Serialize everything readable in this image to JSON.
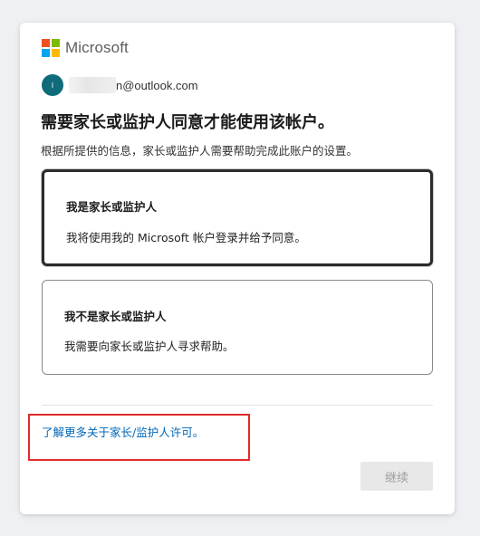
{
  "brand": {
    "name": "Microsoft"
  },
  "account": {
    "avatar_initial": "I",
    "email_visible": "n@outlook.com"
  },
  "header": {
    "title": "需要家长或监护人同意才能使用该帐户。",
    "subtitle": "根据所提供的信息，家长或监护人需要帮助完成此账户的设置。"
  },
  "options": [
    {
      "title": "我是家长或监护人",
      "description": "我将使用我的 Microsoft 帐户登录并给予同意。",
      "selected": true
    },
    {
      "title": "我不是家长或监护人",
      "description": "我需要向家长或监护人寻求帮助。",
      "selected": false
    }
  ],
  "footer": {
    "learn_more": "了解更多关于家长/监护人许可。",
    "continue_label": "继续"
  },
  "colors": {
    "link": "#0067b8",
    "highlight": "#e02b2b",
    "avatar": "#0f6b7a"
  }
}
